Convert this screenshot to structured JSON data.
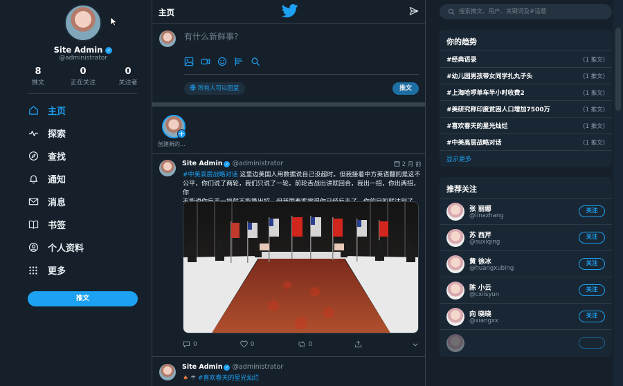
{
  "profile": {
    "name": "Site Admin",
    "verified_badge": "✓",
    "handle": "@administrator",
    "stats": [
      {
        "value": "8",
        "label": "推文"
      },
      {
        "value": "0",
        "label": "正在关注"
      },
      {
        "value": "0",
        "label": "关注者"
      }
    ]
  },
  "nav": {
    "items": [
      {
        "label": "主页",
        "icon": "home-icon"
      },
      {
        "label": "探索",
        "icon": "explore-icon"
      },
      {
        "label": "查找",
        "icon": "compass-icon"
      },
      {
        "label": "通知",
        "icon": "bell-icon"
      },
      {
        "label": "消息",
        "icon": "mail-icon"
      },
      {
        "label": "书签",
        "icon": "bookmark-icon"
      },
      {
        "label": "个人资料",
        "icon": "profile-icon"
      },
      {
        "label": "更多",
        "icon": "more-icon"
      }
    ],
    "tweet_button": "推文"
  },
  "center": {
    "title": "主页",
    "compose": {
      "placeholder": "有什么新鲜事?",
      "audience": "所有人可以回复",
      "submit": "推文"
    },
    "story": {
      "label": "创建新的..."
    },
    "tweets": [
      {
        "name": "Site Admin",
        "handle": "@administrator",
        "time": "2 月 前",
        "hashtag": "#中美高层战略对话",
        "text_1": " 这里边美国人用数据说自己没超时。但我接着中方英语翻的是这不",
        "text_2": "公平，你们说了两轮，我们只说了一轮。前轮舌战出讲就回合，我出一招，你出两招，你",
        "text_3": "不能说你反手一挡就不能算出招，但我国看客觉得你已经反击了，你的目的就达到了。",
        "actions": {
          "reply": "0",
          "like": "0",
          "retweet": "0"
        }
      },
      {
        "name": "Site Admin",
        "handle": "@administrator",
        "text": "#喜欢春天的星光灿烂"
      }
    ]
  },
  "right": {
    "search_placeholder": "搜索推文、用户、关键词及#话题",
    "trends_title": "你的趋势",
    "trends": [
      {
        "name": "#经典语录",
        "count": "(1 推文)"
      },
      {
        "name": "#幼儿园男孩带女同学扎丸子头",
        "count": "(1 推文)"
      },
      {
        "name": "#上海哈啰单车半小时收费2",
        "count": "(1 推文)"
      },
      {
        "name": "#美研究称印度贫困人口增加7500万",
        "count": "(1 推文)"
      },
      {
        "name": "#喜欢春天的星光灿烂",
        "count": "(1 推文)"
      },
      {
        "name": "#中美高层战略对话",
        "count": "(1 推文)"
      }
    ],
    "show_more": "显示更多",
    "follow_title": "推荐关注",
    "follow": [
      {
        "name": "张 丽娜",
        "handle": "@linazhang",
        "button": "关注"
      },
      {
        "name": "苏 西芹",
        "handle": "@suxiqing",
        "button": "关注"
      },
      {
        "name": "黄 徐冰",
        "handle": "@huangxubing",
        "button": "关注"
      },
      {
        "name": "陈 小云",
        "handle": "@cxiisyun",
        "button": "关注"
      },
      {
        "name": "向 晓晓",
        "handle": "@xiangxx",
        "button": "关注"
      }
    ]
  },
  "colors": {
    "background": "#15202b",
    "panel": "#192734",
    "accent": "#1da1f2",
    "border": "#38444d",
    "muted": "#8899a6"
  }
}
